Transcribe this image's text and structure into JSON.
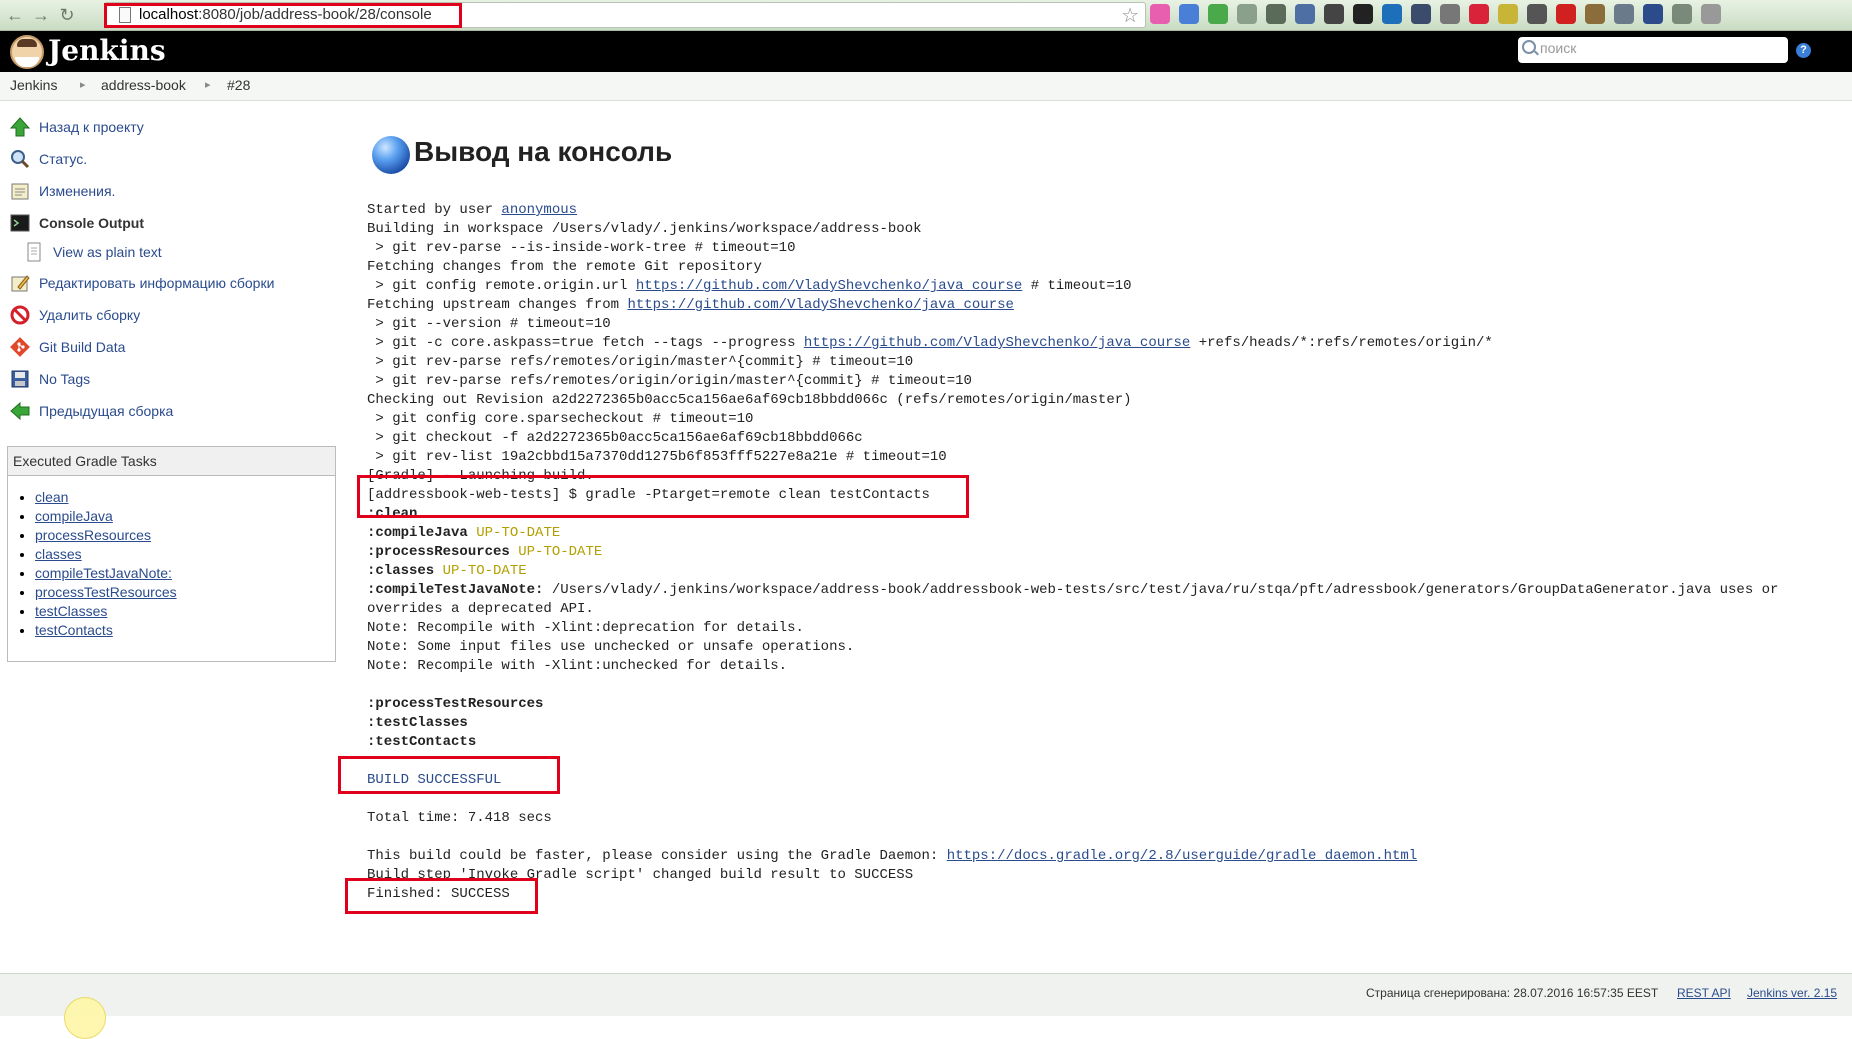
{
  "browser": {
    "url_host": "localhost",
    "url_path": ":8080/job/address-book/28/console"
  },
  "header": {
    "title": "Jenkins",
    "search_placeholder": "поиск",
    "help": "?"
  },
  "breadcrumb": [
    "Jenkins",
    "address-book",
    "#28"
  ],
  "sidebar": {
    "items": [
      {
        "label": "Назад к проекту",
        "icon": "up-arrow-icon"
      },
      {
        "label": "Статус.",
        "icon": "magnifier-icon"
      },
      {
        "label": "Изменения.",
        "icon": "notepad-icon"
      },
      {
        "label": "Console Output",
        "icon": "terminal-icon"
      },
      {
        "label": "View as plain text",
        "icon": "document-icon"
      },
      {
        "label": "Редактировать информацию сборки",
        "icon": "edit-icon"
      },
      {
        "label": "Удалить сборку",
        "icon": "no-entry-icon"
      },
      {
        "label": "Git Build Data",
        "icon": "git-icon"
      },
      {
        "label": "No Tags",
        "icon": "save-icon"
      },
      {
        "label": "Предыдущая сборка",
        "icon": "left-arrow-icon"
      }
    ],
    "gradle_box_title": "Executed Gradle Tasks",
    "gradle_tasks": [
      "clean",
      "compileJava",
      "processResources",
      "classes",
      "compileTestJavaNote:",
      "processTestResources",
      "testClasses",
      "testContacts"
    ]
  },
  "main": {
    "title": "Вывод на консоль",
    "console": {
      "l01a": "Started by user ",
      "l01link": "anonymous",
      "l02": "Building in workspace /Users/vlady/.jenkins/workspace/address-book",
      "l03": " > git rev-parse --is-inside-work-tree # timeout=10",
      "l04": "Fetching changes from the remote Git repository",
      "l05a": " > git config remote.origin.url ",
      "l05link": "https://github.com/VladyShevchenko/java_course",
      "l05b": " # timeout=10",
      "l06a": "Fetching upstream changes from ",
      "l06link": "https://github.com/VladyShevchenko/java_course",
      "l07": " > git --version # timeout=10",
      "l08a": " > git -c core.askpass=true fetch --tags --progress ",
      "l08link": "https://github.com/VladyShevchenko/java_course",
      "l08b": " +refs/heads/*:refs/remotes/origin/*",
      "l09": " > git rev-parse refs/remotes/origin/master^{commit} # timeout=10",
      "l10": " > git rev-parse refs/remotes/origin/origin/master^{commit} # timeout=10",
      "l11": "Checking out Revision a2d2272365b0acc5ca156ae6af69cb18bbdd066c (refs/remotes/origin/master)",
      "l12": " > git config core.sparsecheckout # timeout=10",
      "l13": " > git checkout -f a2d2272365b0acc5ca156ae6af69cb18bbdd066c",
      "l14": " > git rev-list 19a2cbbd15a7370dd1275b6f853fff5227e8a21e # timeout=10",
      "l15": "[Gradle] - Launching build.",
      "l16": "[addressbook-web-tests] $ gradle -Ptarget=remote clean testContacts",
      "l17": ":clean",
      "l18a": ":compileJava",
      "l18b": "UP-TO-DATE",
      "l19a": ":processResources",
      "l19b": "UP-TO-DATE",
      "l20a": ":classes",
      "l20b": "UP-TO-DATE",
      "l21a": ":compileTestJavaNote:",
      "l21b": " /Users/vlady/.jenkins/workspace/address-book/addressbook-web-tests/src/test/java/ru/stqa/pft/adressbook/generators/GroupDataGenerator.java uses or",
      "l22": "overrides a deprecated API.",
      "l23": "Note: Recompile with -Xlint:deprecation for details.",
      "l24": "Note: Some input files use unchecked or unsafe operations.",
      "l25": "Note: Recompile with -Xlint:unchecked for details.",
      "l26": ":processTestResources",
      "l27": ":testClasses",
      "l28": ":testContacts",
      "l29": "BUILD SUCCESSFUL",
      "l30": "Total time: 7.418 secs",
      "l31a": "This build could be faster, please consider using the Gradle Daemon: ",
      "l31link": "https://docs.gradle.org/2.8/userguide/gradle_daemon.html",
      "l32": "Build step 'Invoke Gradle script' changed build result to SUCCESS",
      "l33": "Finished: SUCCESS"
    }
  },
  "footer": {
    "generated": "Страница сгенерирована: 28.07.2016 16:57:35 EEST",
    "rest_api": "REST API",
    "version": "Jenkins ver. 2.15"
  },
  "colors": {
    "highlight": "#e0001b",
    "link": "#2a4b8d",
    "up_to_date": "#b3a000"
  }
}
